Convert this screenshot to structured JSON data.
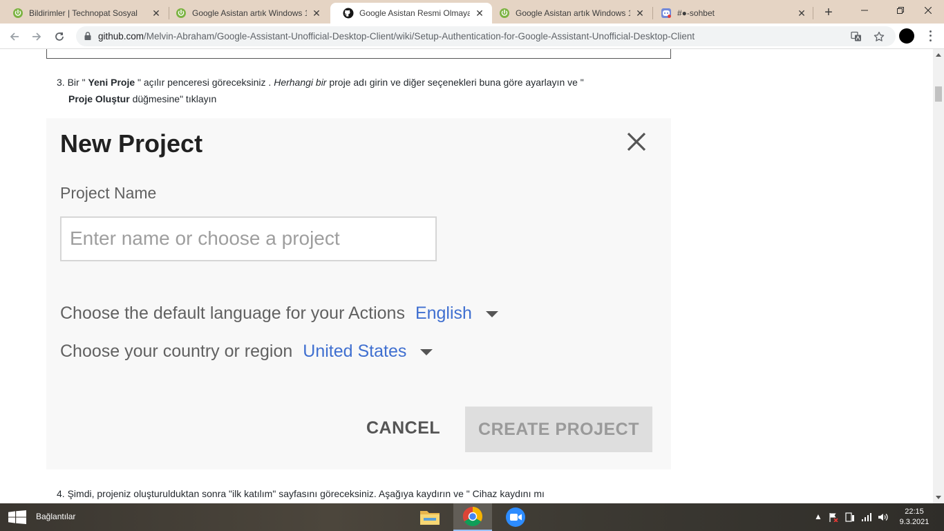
{
  "tabs": [
    {
      "title": "Bildirimler | Technopat Sosyal",
      "favicon": "power-icon"
    },
    {
      "title": "Google Asistan artık Windows 1",
      "favicon": "power-icon"
    },
    {
      "title": "Google Asistan Resmi Olmayan",
      "favicon": "github-icon",
      "active": true
    },
    {
      "title": "Google Asistan artık Windows 1",
      "favicon": "power-icon"
    },
    {
      "title": "#●-sohbet",
      "favicon": "discord-icon"
    }
  ],
  "address": {
    "host": "github.com",
    "path": "/Melvin-Abraham/Google-Assistant-Unofficial-Desktop-Client/wiki/Setup-Authentication-for-Google-Assistant-Unofficial-Desktop-Client"
  },
  "content": {
    "step3": {
      "num": "3.",
      "p1": "Bir \" ",
      "b1": "Yeni Proje",
      "p2": " \" açılır penceresi göreceksiniz . ",
      "i1": "Herhangi bir",
      "p3": " proje adı girin ve diğer seçenekleri buna göre ayarlayın ve \"",
      "b2": "Proje Oluştur",
      "p4": " düğmesine\" tıklayın"
    },
    "dialog": {
      "title": "New Project",
      "project_name_label": "Project Name",
      "input_placeholder": "Enter name or choose a project",
      "language_label": "Choose the default language for your Actions",
      "language_value": "English",
      "country_label": "Choose your country or region",
      "country_value": "United States",
      "cancel": "CANCEL",
      "create": "CREATE PROJECT"
    },
    "step4": {
      "num": "4.",
      "text": "Şimdi, projeniz oluşturulduktan sonra \"ilk katılım\" sayfasını göreceksiniz. Aşağıya kaydırın ve \" Cihaz kaydını mı"
    }
  },
  "taskbar": {
    "label": "Bağlantılar",
    "time": "22:15",
    "date": "9.3.2021"
  }
}
